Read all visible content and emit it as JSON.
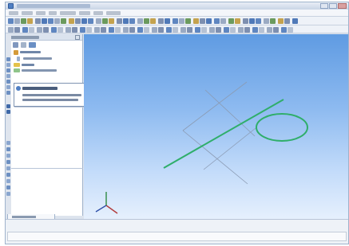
{
  "window": {
    "title": ""
  },
  "menu": [
    {
      "label": ""
    },
    {
      "label": ""
    },
    {
      "label": ""
    },
    {
      "label": ""
    },
    {
      "label": ""
    },
    {
      "label": ""
    },
    {
      "label": ""
    },
    {
      "label": ""
    }
  ],
  "tree_panel": {
    "header": "",
    "nodes": [
      {
        "label": "",
        "icon": "part-icon"
      },
      {
        "label": "",
        "icon": "origin-icon"
      },
      {
        "label": "",
        "icon": "sketch-icon"
      },
      {
        "label": "",
        "icon": "sketch-icon"
      }
    ],
    "tab_label": ""
  },
  "tooltip": {
    "title": "",
    "line1": "",
    "line2": ""
  },
  "status": {
    "text": ""
  },
  "colors": {
    "sketch_line": "#2fae6a",
    "construction_line": "#8b9bb3",
    "viewport_top": "#5f9be2",
    "viewport_bottom": "#e6f0fd",
    "axis_x": "#b23b3b",
    "axis_y": "#2f8a43",
    "axis_z": "#2e4fa8"
  }
}
